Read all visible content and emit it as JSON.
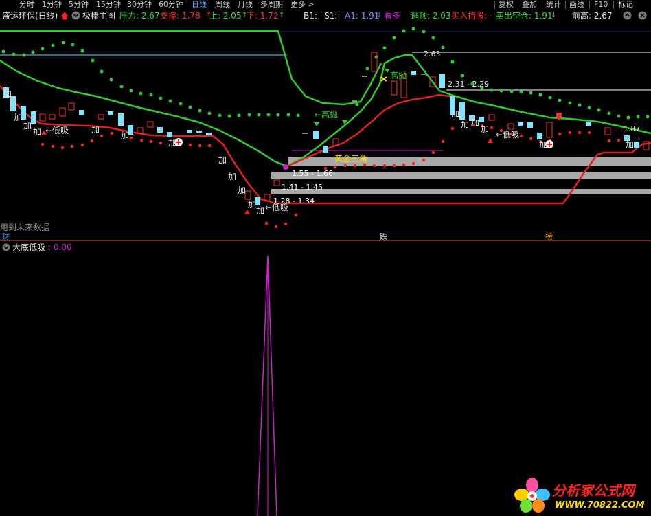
{
  "toolbar": {
    "tabs": [
      "分时",
      "1分钟",
      "5分钟",
      "15分钟",
      "30分钟",
      "60分钟",
      "日线",
      "周线",
      "月线",
      "多周期",
      "更多 >"
    ],
    "active_tab": "日线",
    "right_buttons": [
      "复权",
      "叠加",
      "统计",
      "画线",
      "F10",
      "标记"
    ]
  },
  "infobar": {
    "stock_name": "盛运环保(日线)",
    "indicator_name": "极棒主图",
    "pressure_label": "压力: 2.67",
    "support_label": "支撑: 1.78",
    "up_label": "上: 2.05",
    "down_label": "下: 1.72",
    "b1_label": "B1: -",
    "s1_label": "S1: -",
    "a1_label": "A1: 1.91",
    "bullish_label": "看多",
    "escape_label": "逃顶: 2.03",
    "buy_hold_label": "买入持股: -",
    "sell_empty_label": "卖出空仓: 1.91",
    "prev_high_label": "前高: 2.67"
  },
  "chart_annotations": {
    "high_sell_1": "←高抛",
    "high_sell_2": "高抛",
    "low_buy_1": "←低吸",
    "low_buy_2": "←低吸",
    "low_buy_3": "←低吸",
    "golden_triangle": "黄金三角",
    "price_level_top": "2.63",
    "range_1": "2.31 - 2.29",
    "range_2": "1.55 - 1.66",
    "range_3": "1.41 - 1.45",
    "range_4": "1.28 - 1.34",
    "right_value": "1.87",
    "add_label": "加",
    "future_data": "用到未来数据",
    "marker_cai": "财",
    "marker_die": "跌",
    "marker_bang": "榜"
  },
  "sub_indicator": {
    "name": "大底低吸",
    "value": ": 0.00"
  },
  "logo": {
    "title": "分析家公式网",
    "url": "WWW.70822.COM"
  },
  "colors": {
    "green_line": "#2ecc2e",
    "red_line": "#e02020",
    "cyan_candle": "#7fe5ff",
    "magenta": "#d020d0",
    "gray_band": "#a8a8a8"
  }
}
